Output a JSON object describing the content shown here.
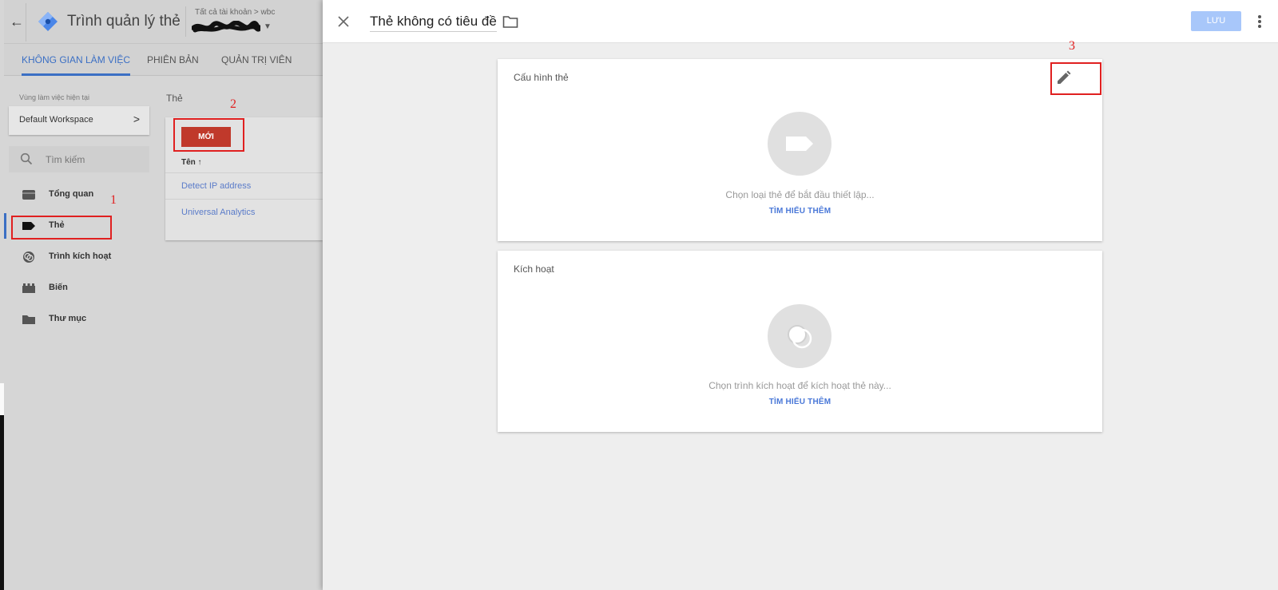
{
  "app": {
    "title": "Trình quản lý thẻ",
    "breadcrumb": "Tất cả tài khoản > wbc"
  },
  "tabs": [
    {
      "label": "KHÔNG GIAN LÀM VIỆC",
      "active": true
    },
    {
      "label": "PHIÊN BẢN",
      "active": false
    },
    {
      "label": "QUẢN TRỊ VIÊN",
      "active": false
    }
  ],
  "workspace": {
    "label": "Vùng làm việc hiện tại",
    "name": "Default Workspace"
  },
  "search": {
    "placeholder": "Tìm kiếm"
  },
  "nav": [
    {
      "label": "Tổng quan",
      "icon": "overview-icon"
    },
    {
      "label": "Thẻ",
      "icon": "tag-icon",
      "active": true
    },
    {
      "label": "Trình kích hoạt",
      "icon": "trigger-icon"
    },
    {
      "label": "Biến",
      "icon": "variable-icon"
    },
    {
      "label": "Thư mục",
      "icon": "folder-icon"
    }
  ],
  "tags_panel": {
    "title": "Thẻ",
    "new_label": "MỚI",
    "column_header": "Tên ↑",
    "rows": [
      "Detect IP address",
      "Universal Analytics"
    ]
  },
  "annotations": [
    "1",
    "2",
    "3"
  ],
  "editor": {
    "title": "Thẻ không có tiêu đề",
    "save_label": "LƯU",
    "tag_config": {
      "title": "Cấu hình thẻ",
      "hint": "Chọn loại thẻ để bắt đầu thiết lập...",
      "learn_more": "TÌM HIỂU THÊM"
    },
    "triggering": {
      "title": "Kích hoạt",
      "hint": "Chọn trình kích hoạt để kích hoạt thẻ này...",
      "learn_more": "TÌM HIỂU THÊM"
    }
  },
  "colors": {
    "accent": "#3b6fc4",
    "new_button": "#c0392b",
    "annotation": "#e02020",
    "save_button": "#a8c7fa",
    "link": "#4a78d8"
  }
}
